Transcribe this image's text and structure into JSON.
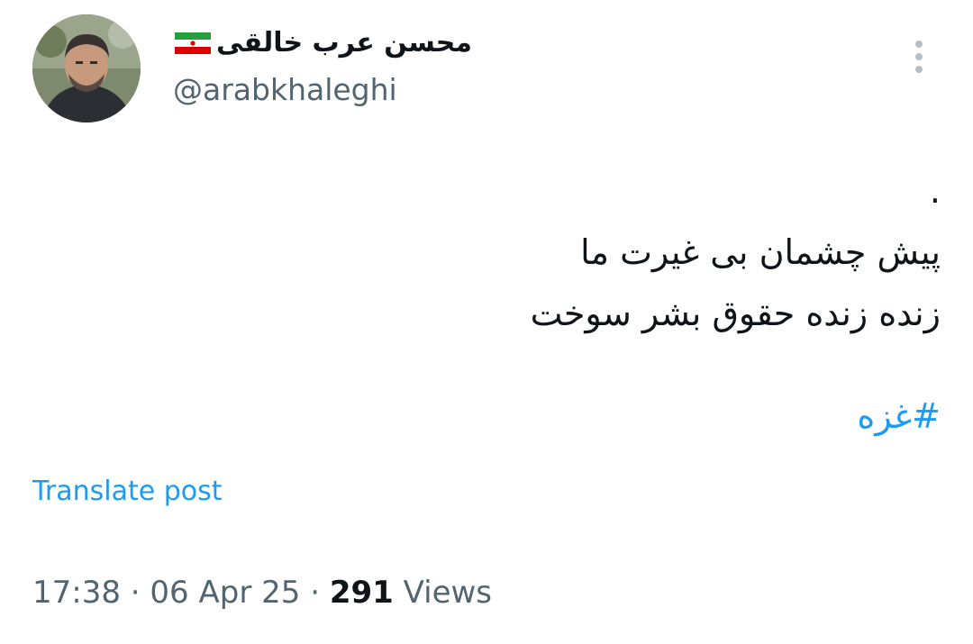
{
  "author": {
    "display_name": "محسن عرب خالقی",
    "handle": "@arabkhaleghi",
    "flag_icon": "iran-flag-icon"
  },
  "post": {
    "lines": [
      ".",
      "پیش چشمان بی غیرت ما",
      "زنده زنده حقوق بشر سوخت"
    ],
    "hashtag": "#غزه"
  },
  "actions": {
    "translate_label": "Translate post",
    "more_icon": "more-vertical-icon"
  },
  "meta": {
    "time": "17:38",
    "separator": "·",
    "date": "06 Apr 25",
    "views_count": "291",
    "views_label": "Views"
  },
  "colors": {
    "link": "#1d9bf0",
    "secondary_text": "#536471",
    "primary_text": "#0f1419"
  }
}
